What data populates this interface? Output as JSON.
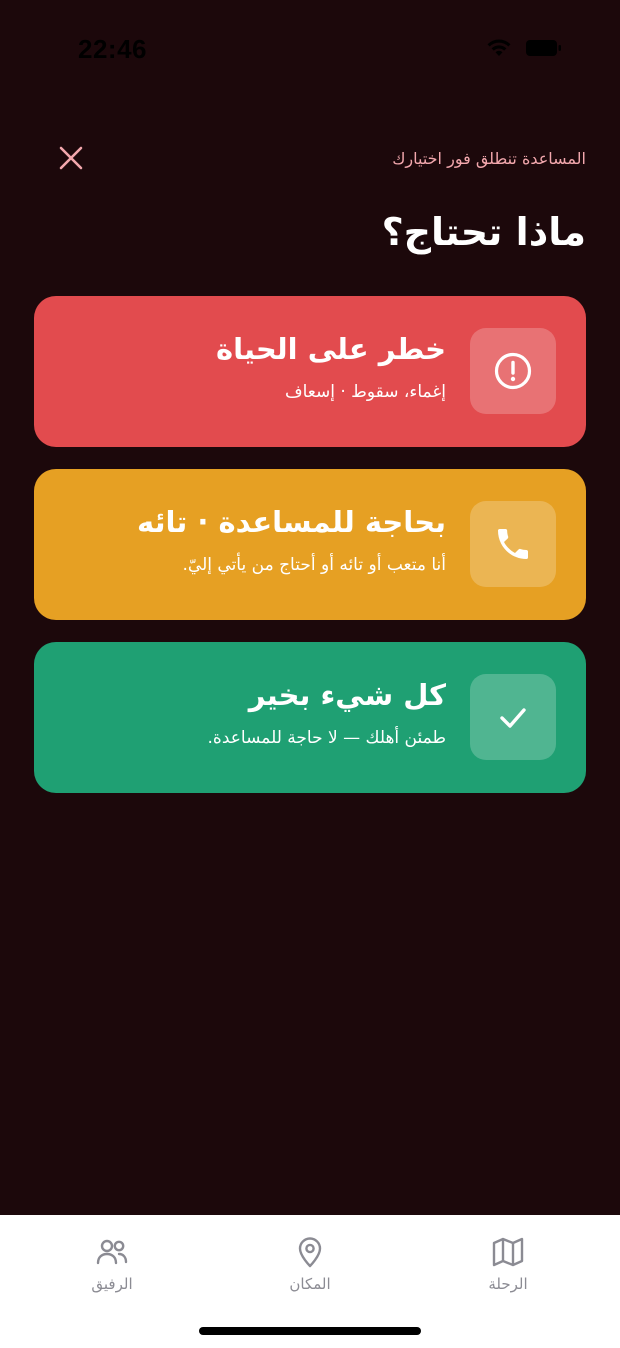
{
  "status_bar": {
    "time": "22:46"
  },
  "header": {
    "hint": "المساعدة تنطلق فور اختيارك",
    "title": "ماذا تحتاج؟"
  },
  "cards": [
    {
      "title": "خطر على الحياة",
      "subtitle": "إغماء، سقوط · إسعاف",
      "icon": "alert-circle-icon",
      "color": "#e24b4e"
    },
    {
      "title": "بحاجة للمساعدة · تائه",
      "subtitle": "أنا متعب أو تائه أو أحتاج من يأتي إليّ.",
      "icon": "phone-icon",
      "color": "#e6a023"
    },
    {
      "title": "كل شيء بخير",
      "subtitle": "طمئن أهلك — لا حاجة للمساعدة.",
      "icon": "check-icon",
      "color": "#1fa073"
    }
  ],
  "bottom_nav": {
    "items": [
      {
        "label": "الرحلة",
        "icon": "map-icon"
      },
      {
        "label": "المكان",
        "icon": "location-pin-icon"
      },
      {
        "label": "الرفيق",
        "icon": "users-icon"
      }
    ]
  }
}
